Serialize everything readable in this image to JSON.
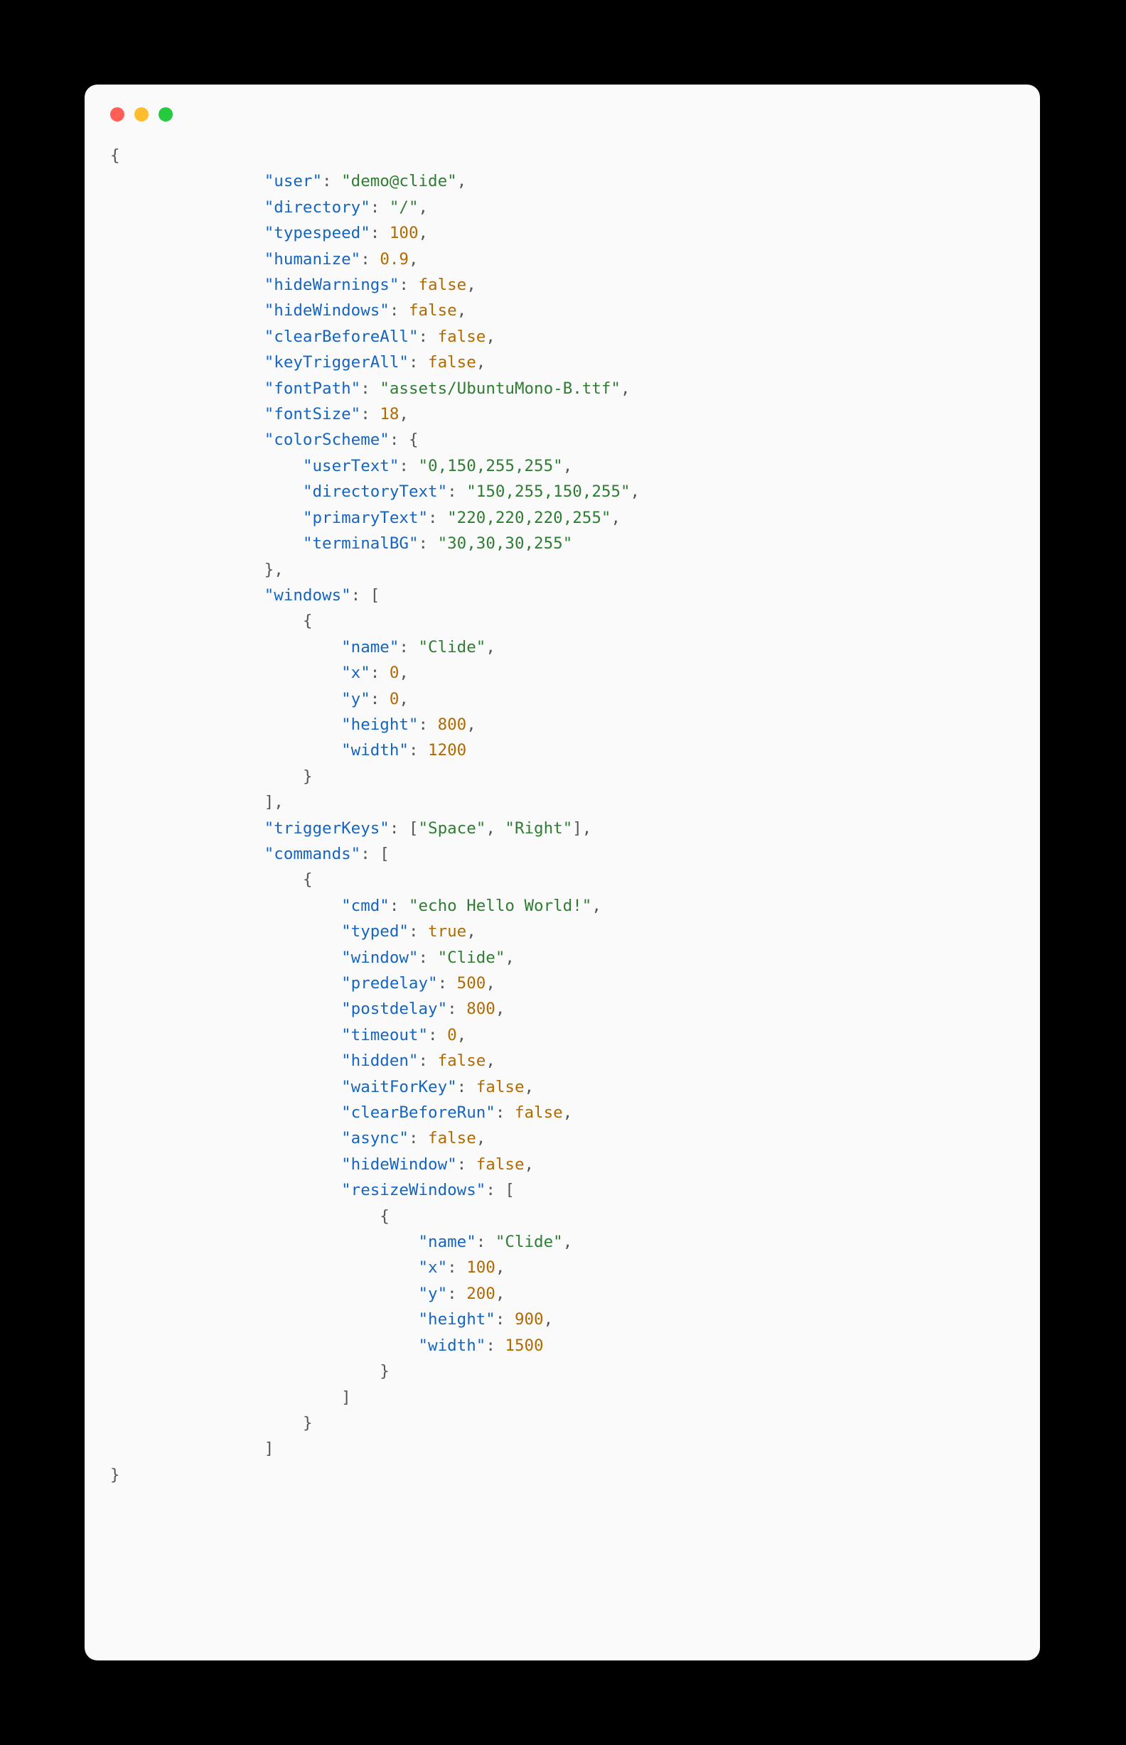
{
  "titlebar": {
    "close": "close",
    "min": "minimize",
    "max": "maximize"
  },
  "code": {
    "tokens": [
      [
        "pun",
        "{"
      ],
      [
        "nl"
      ],
      [
        "ind",
        4
      ],
      [
        "key",
        "\"user\""
      ],
      [
        "pun",
        ": "
      ],
      [
        "str",
        "\"demo@clide\""
      ],
      [
        "pun",
        ","
      ],
      [
        "nl"
      ],
      [
        "ind",
        4
      ],
      [
        "key",
        "\"directory\""
      ],
      [
        "pun",
        ": "
      ],
      [
        "str",
        "\"/\""
      ],
      [
        "pun",
        ","
      ],
      [
        "nl"
      ],
      [
        "ind",
        4
      ],
      [
        "key",
        "\"typespeed\""
      ],
      [
        "pun",
        ": "
      ],
      [
        "num",
        "100"
      ],
      [
        "pun",
        ","
      ],
      [
        "nl"
      ],
      [
        "ind",
        4
      ],
      [
        "key",
        "\"humanize\""
      ],
      [
        "pun",
        ": "
      ],
      [
        "num",
        "0.9"
      ],
      [
        "pun",
        ","
      ],
      [
        "nl"
      ],
      [
        "ind",
        4
      ],
      [
        "key",
        "\"hideWarnings\""
      ],
      [
        "pun",
        ": "
      ],
      [
        "bool",
        "false"
      ],
      [
        "pun",
        ","
      ],
      [
        "nl"
      ],
      [
        "ind",
        4
      ],
      [
        "key",
        "\"hideWindows\""
      ],
      [
        "pun",
        ": "
      ],
      [
        "bool",
        "false"
      ],
      [
        "pun",
        ","
      ],
      [
        "nl"
      ],
      [
        "ind",
        4
      ],
      [
        "key",
        "\"clearBeforeAll\""
      ],
      [
        "pun",
        ": "
      ],
      [
        "bool",
        "false"
      ],
      [
        "pun",
        ","
      ],
      [
        "nl"
      ],
      [
        "ind",
        4
      ],
      [
        "key",
        "\"keyTriggerAll\""
      ],
      [
        "pun",
        ": "
      ],
      [
        "bool",
        "false"
      ],
      [
        "pun",
        ","
      ],
      [
        "nl"
      ],
      [
        "ind",
        4
      ],
      [
        "key",
        "\"fontPath\""
      ],
      [
        "pun",
        ": "
      ],
      [
        "str",
        "\"assets/UbuntuMono-B.ttf\""
      ],
      [
        "pun",
        ","
      ],
      [
        "nl"
      ],
      [
        "ind",
        4
      ],
      [
        "key",
        "\"fontSize\""
      ],
      [
        "pun",
        ": "
      ],
      [
        "num",
        "18"
      ],
      [
        "pun",
        ","
      ],
      [
        "nl"
      ],
      [
        "ind",
        4
      ],
      [
        "key",
        "\"colorScheme\""
      ],
      [
        "pun",
        ": {"
      ],
      [
        "nl"
      ],
      [
        "ind",
        5
      ],
      [
        "key",
        "\"userText\""
      ],
      [
        "pun",
        ": "
      ],
      [
        "str",
        "\"0,150,255,255\""
      ],
      [
        "pun",
        ","
      ],
      [
        "nl"
      ],
      [
        "ind",
        5
      ],
      [
        "key",
        "\"directoryText\""
      ],
      [
        "pun",
        ": "
      ],
      [
        "str",
        "\"150,255,150,255\""
      ],
      [
        "pun",
        ","
      ],
      [
        "nl"
      ],
      [
        "ind",
        5
      ],
      [
        "key",
        "\"primaryText\""
      ],
      [
        "pun",
        ": "
      ],
      [
        "str",
        "\"220,220,220,255\""
      ],
      [
        "pun",
        ","
      ],
      [
        "nl"
      ],
      [
        "ind",
        5
      ],
      [
        "key",
        "\"terminalBG\""
      ],
      [
        "pun",
        ": "
      ],
      [
        "str",
        "\"30,30,30,255\""
      ],
      [
        "nl"
      ],
      [
        "ind",
        4
      ],
      [
        "pun",
        "},"
      ],
      [
        "nl"
      ],
      [
        "ind",
        4
      ],
      [
        "key",
        "\"windows\""
      ],
      [
        "pun",
        ": ["
      ],
      [
        "nl"
      ],
      [
        "ind",
        5
      ],
      [
        "pun",
        "{"
      ],
      [
        "nl"
      ],
      [
        "ind",
        6
      ],
      [
        "key",
        "\"name\""
      ],
      [
        "pun",
        ": "
      ],
      [
        "str",
        "\"Clide\""
      ],
      [
        "pun",
        ","
      ],
      [
        "nl"
      ],
      [
        "ind",
        6
      ],
      [
        "key",
        "\"x\""
      ],
      [
        "pun",
        ": "
      ],
      [
        "num",
        "0"
      ],
      [
        "pun",
        ","
      ],
      [
        "nl"
      ],
      [
        "ind",
        6
      ],
      [
        "key",
        "\"y\""
      ],
      [
        "pun",
        ": "
      ],
      [
        "num",
        "0"
      ],
      [
        "pun",
        ","
      ],
      [
        "nl"
      ],
      [
        "ind",
        6
      ],
      [
        "key",
        "\"height\""
      ],
      [
        "pun",
        ": "
      ],
      [
        "num",
        "800"
      ],
      [
        "pun",
        ","
      ],
      [
        "nl"
      ],
      [
        "ind",
        6
      ],
      [
        "key",
        "\"width\""
      ],
      [
        "pun",
        ": "
      ],
      [
        "num",
        "1200"
      ],
      [
        "nl"
      ],
      [
        "ind",
        5
      ],
      [
        "pun",
        "}"
      ],
      [
        "nl"
      ],
      [
        "ind",
        4
      ],
      [
        "pun",
        "],"
      ],
      [
        "nl"
      ],
      [
        "ind",
        4
      ],
      [
        "key",
        "\"triggerKeys\""
      ],
      [
        "pun",
        ": ["
      ],
      [
        "str",
        "\"Space\""
      ],
      [
        "pun",
        ", "
      ],
      [
        "str",
        "\"Right\""
      ],
      [
        "pun",
        "],"
      ],
      [
        "nl"
      ],
      [
        "ind",
        4
      ],
      [
        "key",
        "\"commands\""
      ],
      [
        "pun",
        ": ["
      ],
      [
        "nl"
      ],
      [
        "ind",
        5
      ],
      [
        "pun",
        "{"
      ],
      [
        "nl"
      ],
      [
        "ind",
        6
      ],
      [
        "key",
        "\"cmd\""
      ],
      [
        "pun",
        ": "
      ],
      [
        "str",
        "\"echo Hello World!\""
      ],
      [
        "pun",
        ","
      ],
      [
        "nl"
      ],
      [
        "ind",
        6
      ],
      [
        "key",
        "\"typed\""
      ],
      [
        "pun",
        ": "
      ],
      [
        "bool",
        "true"
      ],
      [
        "pun",
        ","
      ],
      [
        "nl"
      ],
      [
        "ind",
        6
      ],
      [
        "key",
        "\"window\""
      ],
      [
        "pun",
        ": "
      ],
      [
        "str",
        "\"Clide\""
      ],
      [
        "pun",
        ","
      ],
      [
        "nl"
      ],
      [
        "ind",
        6
      ],
      [
        "key",
        "\"predelay\""
      ],
      [
        "pun",
        ": "
      ],
      [
        "num",
        "500"
      ],
      [
        "pun",
        ","
      ],
      [
        "nl"
      ],
      [
        "ind",
        6
      ],
      [
        "key",
        "\"postdelay\""
      ],
      [
        "pun",
        ": "
      ],
      [
        "num",
        "800"
      ],
      [
        "pun",
        ","
      ],
      [
        "nl"
      ],
      [
        "ind",
        6
      ],
      [
        "key",
        "\"timeout\""
      ],
      [
        "pun",
        ": "
      ],
      [
        "num",
        "0"
      ],
      [
        "pun",
        ","
      ],
      [
        "nl"
      ],
      [
        "ind",
        6
      ],
      [
        "key",
        "\"hidden\""
      ],
      [
        "pun",
        ": "
      ],
      [
        "bool",
        "false"
      ],
      [
        "pun",
        ","
      ],
      [
        "nl"
      ],
      [
        "ind",
        6
      ],
      [
        "key",
        "\"waitForKey\""
      ],
      [
        "pun",
        ": "
      ],
      [
        "bool",
        "false"
      ],
      [
        "pun",
        ","
      ],
      [
        "nl"
      ],
      [
        "ind",
        6
      ],
      [
        "key",
        "\"clearBeforeRun\""
      ],
      [
        "pun",
        ": "
      ],
      [
        "bool",
        "false"
      ],
      [
        "pun",
        ","
      ],
      [
        "nl"
      ],
      [
        "ind",
        6
      ],
      [
        "key",
        "\"async\""
      ],
      [
        "pun",
        ": "
      ],
      [
        "bool",
        "false"
      ],
      [
        "pun",
        ","
      ],
      [
        "nl"
      ],
      [
        "ind",
        6
      ],
      [
        "key",
        "\"hideWindow\""
      ],
      [
        "pun",
        ": "
      ],
      [
        "bool",
        "false"
      ],
      [
        "pun",
        ","
      ],
      [
        "nl"
      ],
      [
        "ind",
        6
      ],
      [
        "key",
        "\"resizeWindows\""
      ],
      [
        "pun",
        ": ["
      ],
      [
        "nl"
      ],
      [
        "ind",
        7
      ],
      [
        "pun",
        "{"
      ],
      [
        "nl"
      ],
      [
        "ind",
        8
      ],
      [
        "key",
        "\"name\""
      ],
      [
        "pun",
        ": "
      ],
      [
        "str",
        "\"Clide\""
      ],
      [
        "pun",
        ","
      ],
      [
        "nl"
      ],
      [
        "ind",
        8
      ],
      [
        "key",
        "\"x\""
      ],
      [
        "pun",
        ": "
      ],
      [
        "num",
        "100"
      ],
      [
        "pun",
        ","
      ],
      [
        "nl"
      ],
      [
        "ind",
        8
      ],
      [
        "key",
        "\"y\""
      ],
      [
        "pun",
        ": "
      ],
      [
        "num",
        "200"
      ],
      [
        "pun",
        ","
      ],
      [
        "nl"
      ],
      [
        "ind",
        8
      ],
      [
        "key",
        "\"height\""
      ],
      [
        "pun",
        ": "
      ],
      [
        "num",
        "900"
      ],
      [
        "pun",
        ","
      ],
      [
        "nl"
      ],
      [
        "ind",
        8
      ],
      [
        "key",
        "\"width\""
      ],
      [
        "pun",
        ": "
      ],
      [
        "num",
        "1500"
      ],
      [
        "nl"
      ],
      [
        "ind",
        7
      ],
      [
        "pun",
        "}"
      ],
      [
        "nl"
      ],
      [
        "ind",
        6
      ],
      [
        "pun",
        "]"
      ],
      [
        "nl"
      ],
      [
        "ind",
        5
      ],
      [
        "pun",
        "}"
      ],
      [
        "nl"
      ],
      [
        "ind",
        4
      ],
      [
        "pun",
        "]"
      ],
      [
        "nl"
      ],
      [
        "pun",
        "}"
      ]
    ]
  }
}
